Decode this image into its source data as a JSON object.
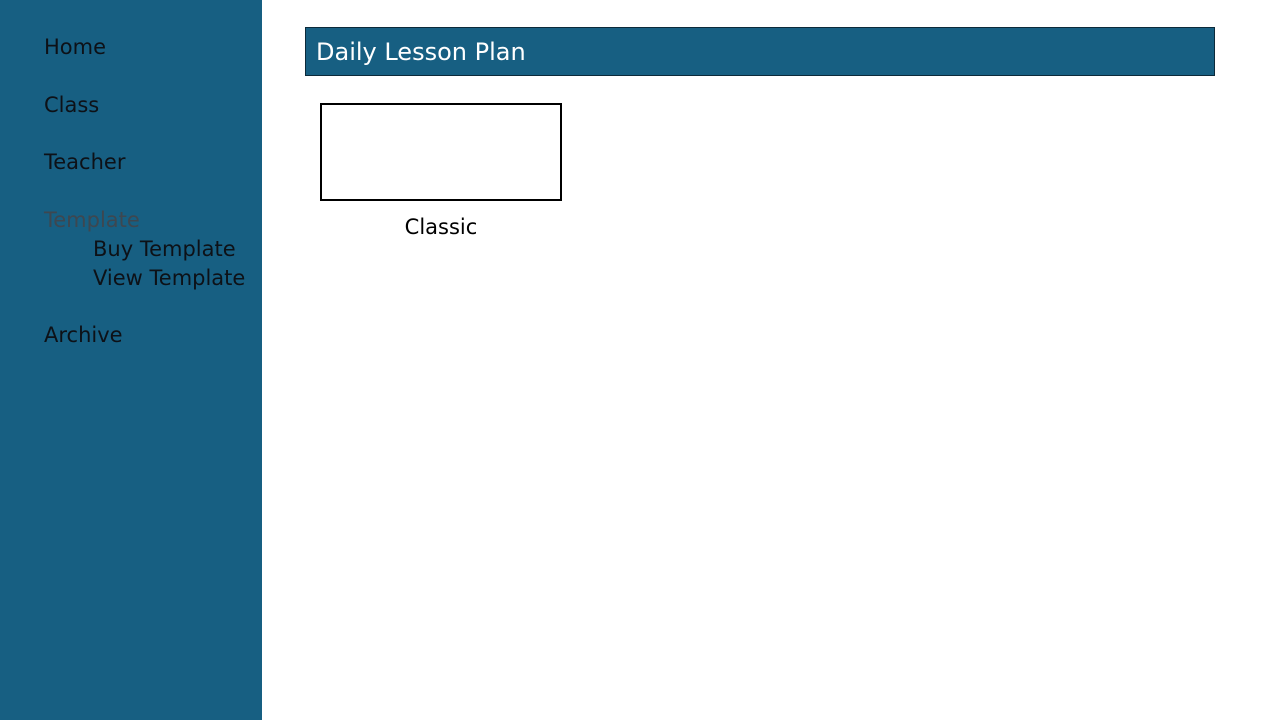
{
  "sidebar": {
    "items": [
      {
        "label": "Home"
      },
      {
        "label": "Class"
      },
      {
        "label": "Teacher"
      },
      {
        "label": "Template"
      },
      {
        "label": "Archive"
      }
    ],
    "template_subitems": [
      {
        "label": "Buy Template"
      },
      {
        "label": "View Template"
      }
    ]
  },
  "header": {
    "title": "Daily Lesson Plan"
  },
  "templates": [
    {
      "label": "Classic"
    }
  ],
  "colors": {
    "sidebar_bg": "#175f82",
    "title_bar_bg": "#175f82",
    "nav_text": "#0d1117",
    "nav_disabled_text": "#3d4750"
  }
}
